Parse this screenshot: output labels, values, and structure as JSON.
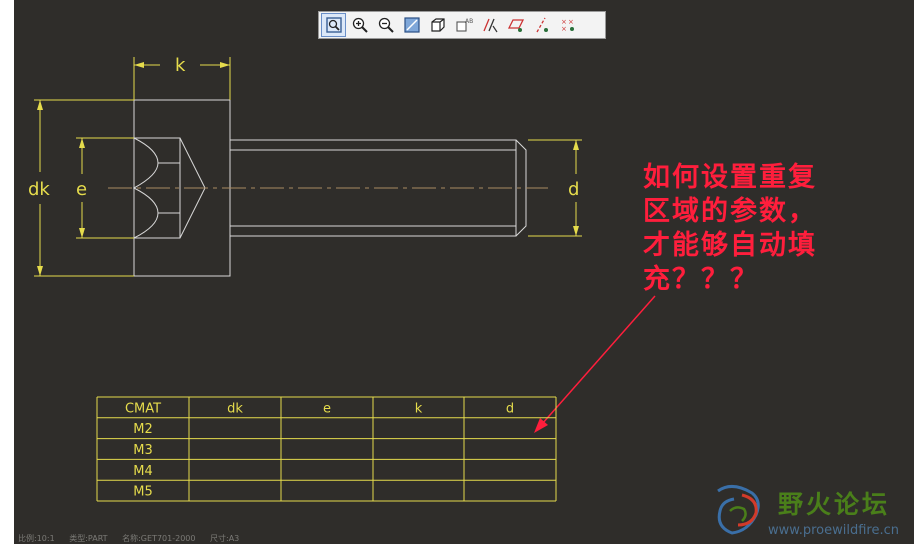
{
  "toolbar": {
    "buttons": [
      {
        "name": "zoom-fit-icon",
        "active": true
      },
      {
        "name": "zoom-in-icon",
        "active": false
      },
      {
        "name": "zoom-out-icon",
        "active": false
      },
      {
        "name": "repaint-icon",
        "active": false
      },
      {
        "name": "display-style-icon",
        "active": false
      },
      {
        "name": "saved-views-icon",
        "active": false
      },
      {
        "name": "datum-display-icon",
        "active": false
      },
      {
        "name": "plane-display-icon",
        "active": false
      },
      {
        "name": "axis-display-icon",
        "active": false
      },
      {
        "name": "point-display-icon",
        "active": false
      }
    ]
  },
  "drawing": {
    "dim_k": "k",
    "dim_dk": "dk",
    "dim_e": "e",
    "dim_d": "d"
  },
  "table": {
    "headers": [
      "CMAT",
      "dk",
      "e",
      "k",
      "d"
    ],
    "rows": [
      [
        "M2",
        "",
        "",
        "",
        ""
      ],
      [
        "M3",
        "",
        "",
        "",
        ""
      ],
      [
        "M4",
        "",
        "",
        "",
        ""
      ],
      [
        "M5",
        "",
        "",
        "",
        ""
      ]
    ]
  },
  "annotation": {
    "lines": [
      "如何设置重复",
      "区域的参数，",
      "才能够自动填",
      "充？？？"
    ]
  },
  "status": {
    "scale": "比例:10:1",
    "type": "类型:PART",
    "name": "名称:GET701-2000",
    "size": "尺寸:A3"
  },
  "logo": {
    "title": "野火论坛",
    "url": "www.proewildfire.cn"
  },
  "colors": {
    "background": "#2f2d2a",
    "dimension": "#e6dc4c",
    "geometry": "#d8d8d8",
    "centerline": "#a88a63",
    "annotation": "#ff1e3c"
  }
}
